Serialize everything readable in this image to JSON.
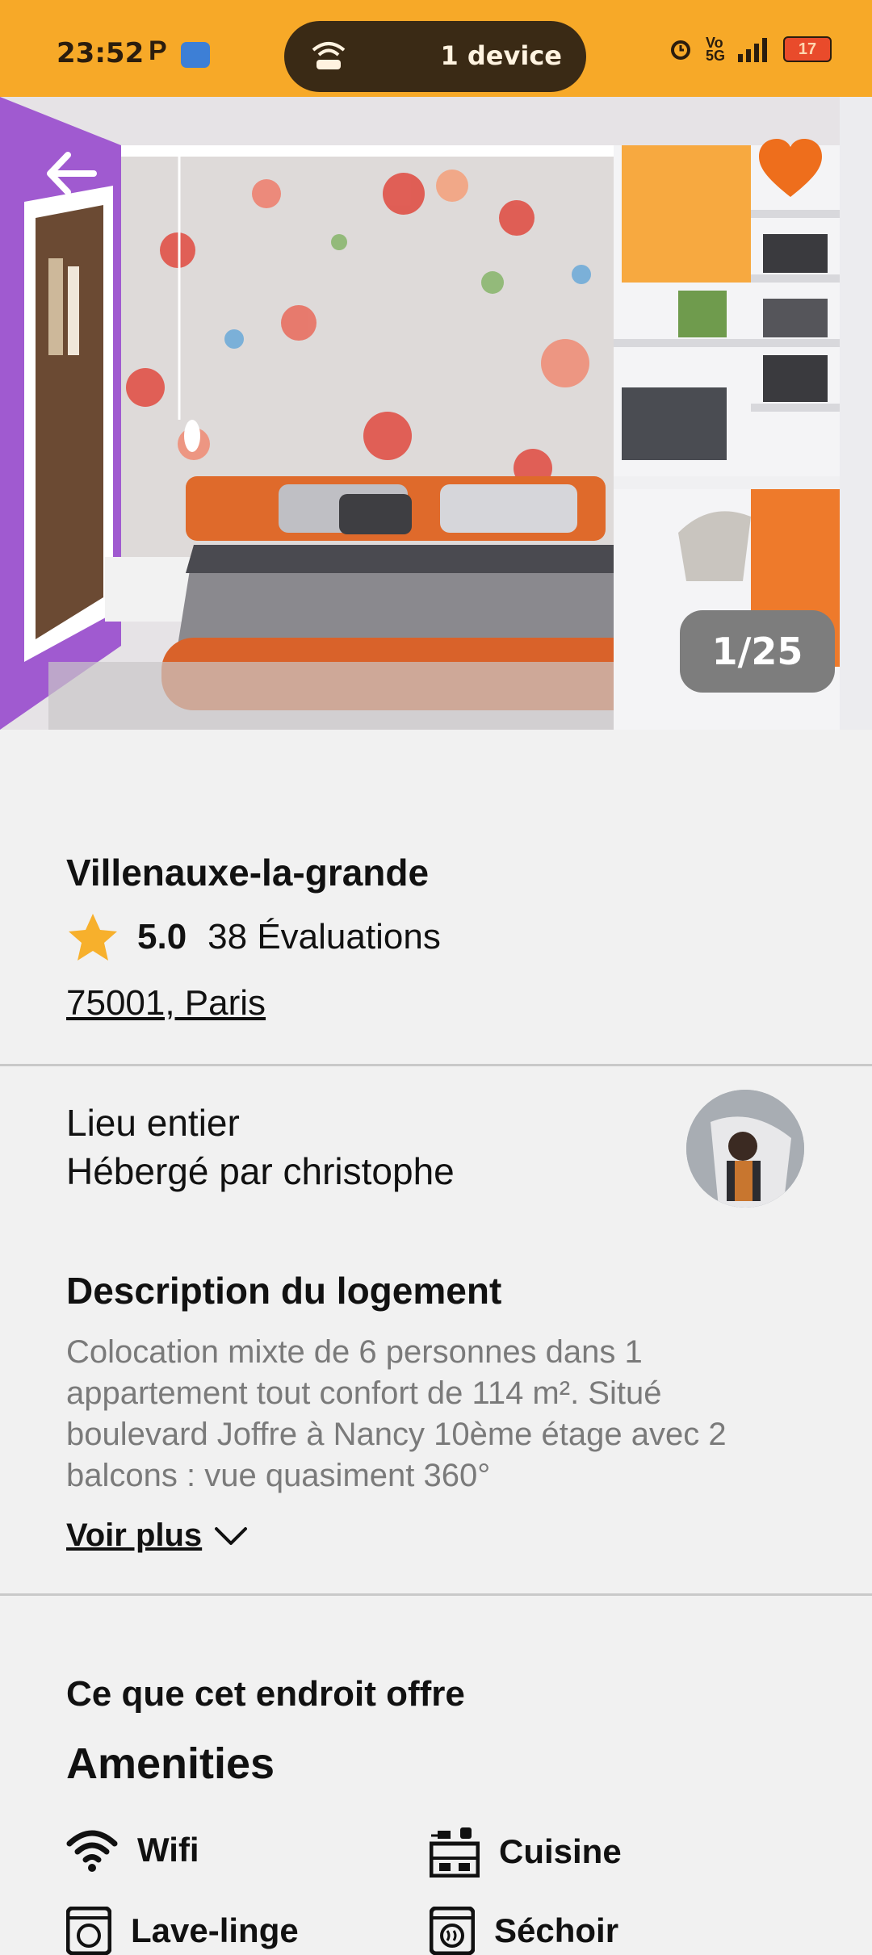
{
  "status_bar": {
    "time": "23:52",
    "p_indicator": "P",
    "hotspot_label": "1 device",
    "network_small_1": "Vo",
    "network_small_2": "5G",
    "battery_level": "17"
  },
  "gallery": {
    "counter": "1/25",
    "accent_color": "#ee6e1c"
  },
  "listing": {
    "title": "Villenauxe-la-grande",
    "rating": "5.0",
    "reviews": "38 Évaluations",
    "location": "75001, Paris"
  },
  "host": {
    "place_type": "Lieu entier",
    "hosted_by": "Hébergé par christophe"
  },
  "description": {
    "title": "Description du logement",
    "text": "Colocation mixte de 6 personnes dans 1 appartement tout confort de 114 m². Situé boulevard Joffre à Nancy 10ème étage avec 2 balcons : vue quasiment 360°",
    "see_more": "Voir plus"
  },
  "offers": {
    "title": "Ce que cet endroit offre",
    "amenities_title": "Amenities",
    "items": [
      {
        "label": "Wifi",
        "icon": "wifi-icon"
      },
      {
        "label": "Cuisine",
        "icon": "kitchen-icon"
      },
      {
        "label": "Lave-linge",
        "icon": "washer-icon"
      },
      {
        "label": "Séchoir",
        "icon": "dryer-icon"
      }
    ]
  }
}
